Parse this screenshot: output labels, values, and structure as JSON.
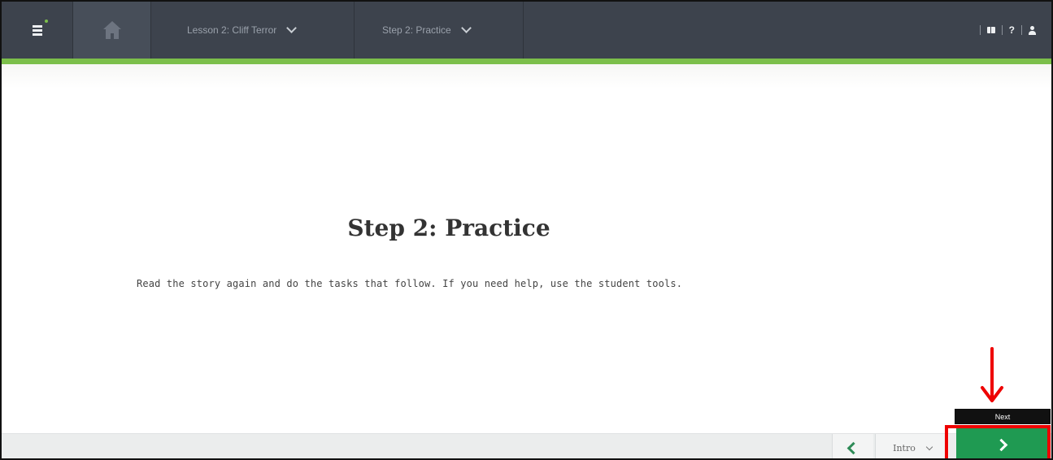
{
  "topbar": {
    "lesson_label": "Lesson 2: Cliff Terror",
    "step_label": "Step 2: Practice",
    "tools": {
      "book_icon": "book-icon",
      "help_label": "?",
      "user_icon": "user-icon"
    }
  },
  "main": {
    "title": "Step 2: Practice",
    "instructions": "Read the story again and do the tasks that follow. If you need help, use the student tools."
  },
  "bottom_nav": {
    "section_select_value": "Intro",
    "next_tooltip": "Next"
  },
  "colors": {
    "topbar": "#3d434d",
    "accent_green": "#7cbf4a",
    "next_button": "#1f9a52",
    "annotation_red": "#ee0000"
  }
}
